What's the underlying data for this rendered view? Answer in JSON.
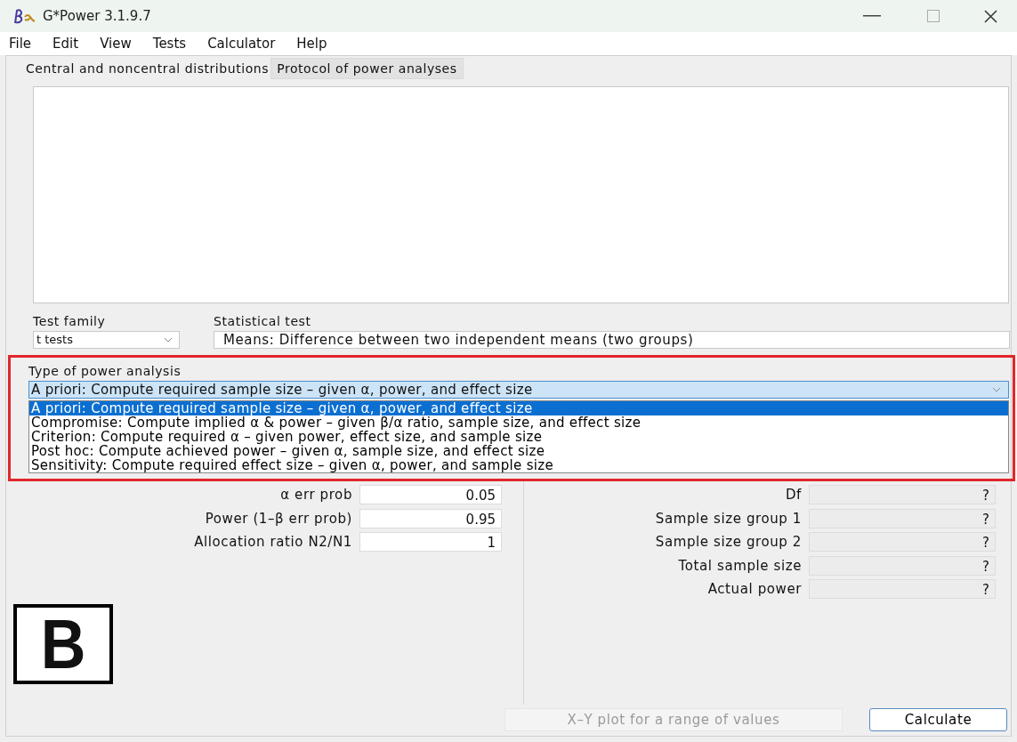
{
  "window": {
    "title": "G*Power 3.1.9.7"
  },
  "menu": [
    "File",
    "Edit",
    "View",
    "Tests",
    "Calculator",
    "Help"
  ],
  "tabs": [
    {
      "label": "Central and noncentral distributions",
      "selected": true
    },
    {
      "label": "Protocol of power analyses",
      "selected": false
    }
  ],
  "test_family": {
    "label": "Test family",
    "value": "t tests"
  },
  "statistical_test": {
    "label": "Statistical test",
    "value": "Means: Difference between two independent means (two groups)"
  },
  "type_of_power_analysis": {
    "label": "Type of power analysis",
    "value": "A priori: Compute required sample size – given α, power, and effect size",
    "expanded": true,
    "options": [
      {
        "label": "A priori: Compute required sample size – given α, power, and effect size",
        "selected": true
      },
      {
        "label": "Compromise: Compute implied α & power – given β/α ratio, sample size, and effect size",
        "selected": false
      },
      {
        "label": "Criterion: Compute required α – given power, effect size, and sample size",
        "selected": false
      },
      {
        "label": "Post hoc: Compute achieved power – given α, sample size, and effect size",
        "selected": false
      },
      {
        "label": "Sensitivity: Compute required effect size – given α, power, and sample size",
        "selected": false
      }
    ]
  },
  "input_parameters": [
    {
      "label": "α err prob",
      "value": "0.05"
    },
    {
      "label": "Power (1–β err prob)",
      "value": "0.95"
    },
    {
      "label": "Allocation ratio N2/N1",
      "value": "1"
    }
  ],
  "output_parameters": [
    {
      "label": "Df",
      "value": "?"
    },
    {
      "label": "Sample size group 1",
      "value": "?"
    },
    {
      "label": "Sample size group 2",
      "value": "?"
    },
    {
      "label": "Total sample size",
      "value": "?"
    },
    {
      "label": "Actual power",
      "value": "?"
    }
  ],
  "panel_label": "B",
  "buttons": [
    {
      "label": "X–Y plot for a range of values",
      "disabled": true
    },
    {
      "label": "Calculate",
      "disabled": false
    }
  ]
}
